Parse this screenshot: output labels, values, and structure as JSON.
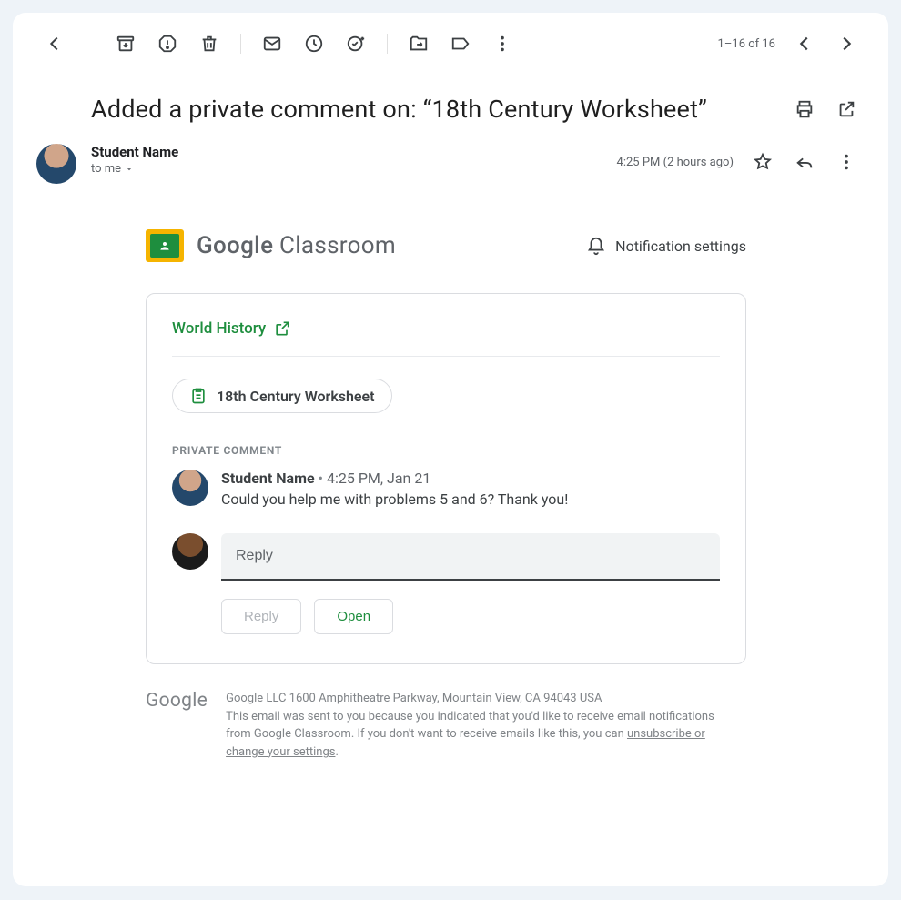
{
  "toolbar": {
    "page_count": "1–16 of 16"
  },
  "email": {
    "subject": "Added a private comment on: “18th Century Worksheet”",
    "sender_name": "Student Name",
    "recipient_label": "to me",
    "timestamp": "4:25 PM (2 hours ago)"
  },
  "classroom": {
    "brand_bold": "Google",
    "brand_light": " Classroom",
    "notification_settings_label": "Notification settings",
    "class_name": "World History",
    "assignment_chip": "18th Century Worksheet",
    "section_label": "PRIVATE COMMENT",
    "comment": {
      "author": "Student Name",
      "timestamp": "4:25 PM, Jan 21",
      "text": "Could you help me with problems 5 and 6? Thank you!"
    },
    "reply_placeholder": "Reply",
    "reply_button": "Reply",
    "open_button": "Open"
  },
  "footer": {
    "logo": "Google",
    "line1": "Google LLC 1600 Amphitheatre Parkway, Mountain View, CA 94043 USA",
    "line2a": "This email was sent to you because you indicated that you'd like to receive email notifications from Google Classroom. If you don't want to receive emails like this, you can ",
    "unsubscribe": "unsubscribe or change your settings",
    "line2b": "."
  }
}
